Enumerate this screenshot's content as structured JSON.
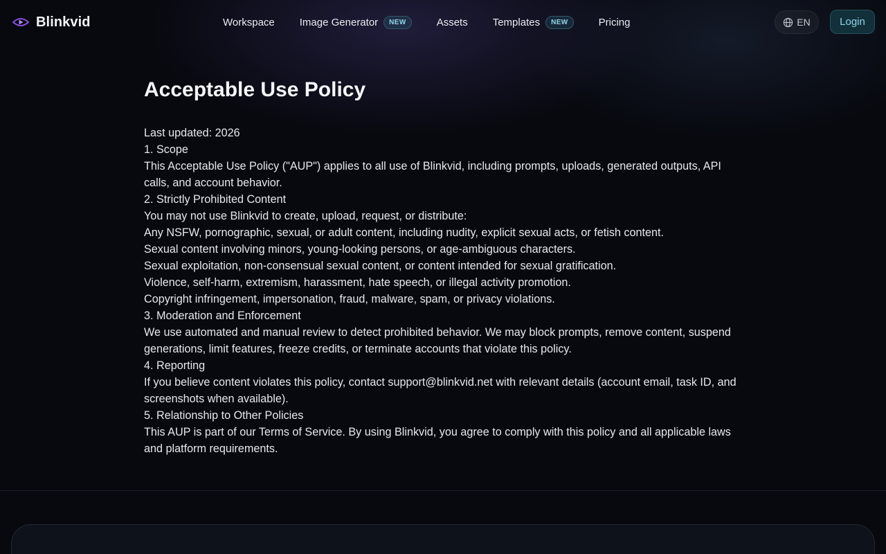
{
  "nav": {
    "brand": "Blinkvid",
    "links": [
      {
        "label": "Workspace",
        "badge": ""
      },
      {
        "label": "Image Generator",
        "badge": "NEW"
      },
      {
        "label": "Assets",
        "badge": ""
      },
      {
        "label": "Templates",
        "badge": "NEW"
      },
      {
        "label": "Pricing",
        "badge": ""
      }
    ],
    "language": "EN",
    "login_label": "Login"
  },
  "page": {
    "title": "Acceptable Use Policy",
    "lines": [
      "Last updated: 2026",
      "1. Scope",
      "This Acceptable Use Policy (\"AUP\") applies to all use of Blinkvid, including prompts, uploads, generated outputs, API calls, and account behavior.",
      "2. Strictly Prohibited Content",
      "You may not use Blinkvid to create, upload, request, or distribute:",
      "Any NSFW, pornographic, sexual, or adult content, including nudity, explicit sexual acts, or fetish content.",
      "Sexual content involving minors, young-looking persons, or age-ambiguous characters.",
      "Sexual exploitation, non-consensual sexual content, or content intended for sexual gratification.",
      "Violence, self-harm, extremism, harassment, hate speech, or illegal activity promotion.",
      "Copyright infringement, impersonation, fraud, malware, spam, or privacy violations.",
      "3. Moderation and Enforcement",
      "We use automated and manual review to detect prohibited behavior. We may block prompts, remove content, suspend generations, limit features, freeze credits, or terminate accounts that violate this policy.",
      "4. Reporting",
      "If you believe content violates this policy, contact support@blinkvid.net with relevant details (account email, task ID, and screenshots when available).",
      "5. Relationship to Other Policies",
      "This AUP is part of our Terms of Service. By using Blinkvid, you agree to comply with this policy and all applicable laws and platform requirements."
    ]
  },
  "colors": {
    "background": "#07090f",
    "accent": "#8fd4e6",
    "brand_logo": "#8b4fe0"
  },
  "icons": {
    "brand": "eye-play-logo-icon",
    "language": "globe-icon"
  }
}
